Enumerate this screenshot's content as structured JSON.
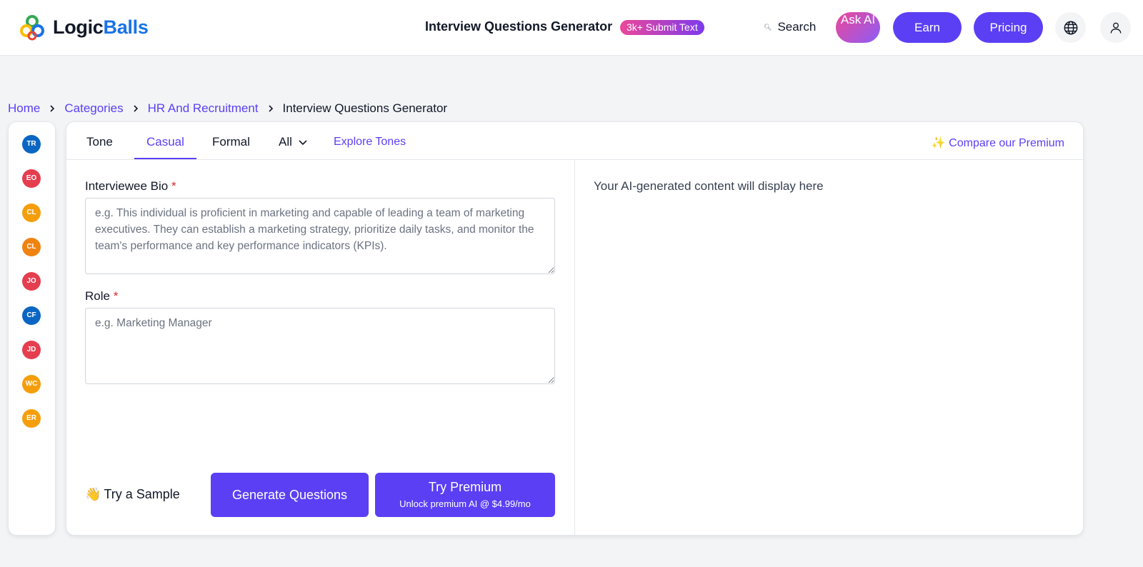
{
  "header": {
    "logo_part1": "Logic",
    "logo_part2": "Balls",
    "tool_title": "Interview Questions Generator",
    "submit_badge": "3k+ Submit Text",
    "search_label": "Search",
    "ask_ai_label": "Ask AI",
    "earn_label": "Earn",
    "pricing_label": "Pricing",
    "accent_color": "#5b3ff5"
  },
  "breadcrumb": {
    "items": [
      "Home",
      "Categories",
      "HR And Recruitment"
    ],
    "current": "Interview Questions Generator"
  },
  "sidebar": {
    "avatars": [
      {
        "initials": "TR",
        "color": "#0a66c2"
      },
      {
        "initials": "EO",
        "color": "#e53e4f"
      },
      {
        "initials": "CL",
        "color": "#f59e0b"
      },
      {
        "initials": "CL",
        "color": "#f0820f"
      },
      {
        "initials": "JO",
        "color": "#e53e4f"
      },
      {
        "initials": "CF",
        "color": "#0a66c2"
      },
      {
        "initials": "JD",
        "color": "#e53e4f"
      },
      {
        "initials": "WC",
        "color": "#f59e0b"
      },
      {
        "initials": "ER",
        "color": "#f59e0b"
      }
    ]
  },
  "tabs": {
    "tone": "Tone",
    "casual": "Casual",
    "formal": "Formal",
    "all": "All",
    "explore": "Explore Tones",
    "compare": "✨ Compare our Premium"
  },
  "form": {
    "bio_label": "Interviewee Bio",
    "bio_placeholder": "e.g. This individual is proficient in marketing and capable of leading a team of marketing executives. They can establish a marketing strategy, prioritize daily tasks, and monitor the team's performance and key performance indicators (KPIs).",
    "role_label": "Role",
    "role_placeholder": "e.g. Marketing Manager",
    "required_mark": "*",
    "try_sample_emoji": "👋",
    "try_sample": "Try a Sample",
    "generate": "Generate Questions",
    "premium_title": "Try Premium",
    "premium_sub": "Unlock premium AI @ $4.99/mo"
  },
  "output": {
    "placeholder": "Your AI-generated content will display here"
  }
}
